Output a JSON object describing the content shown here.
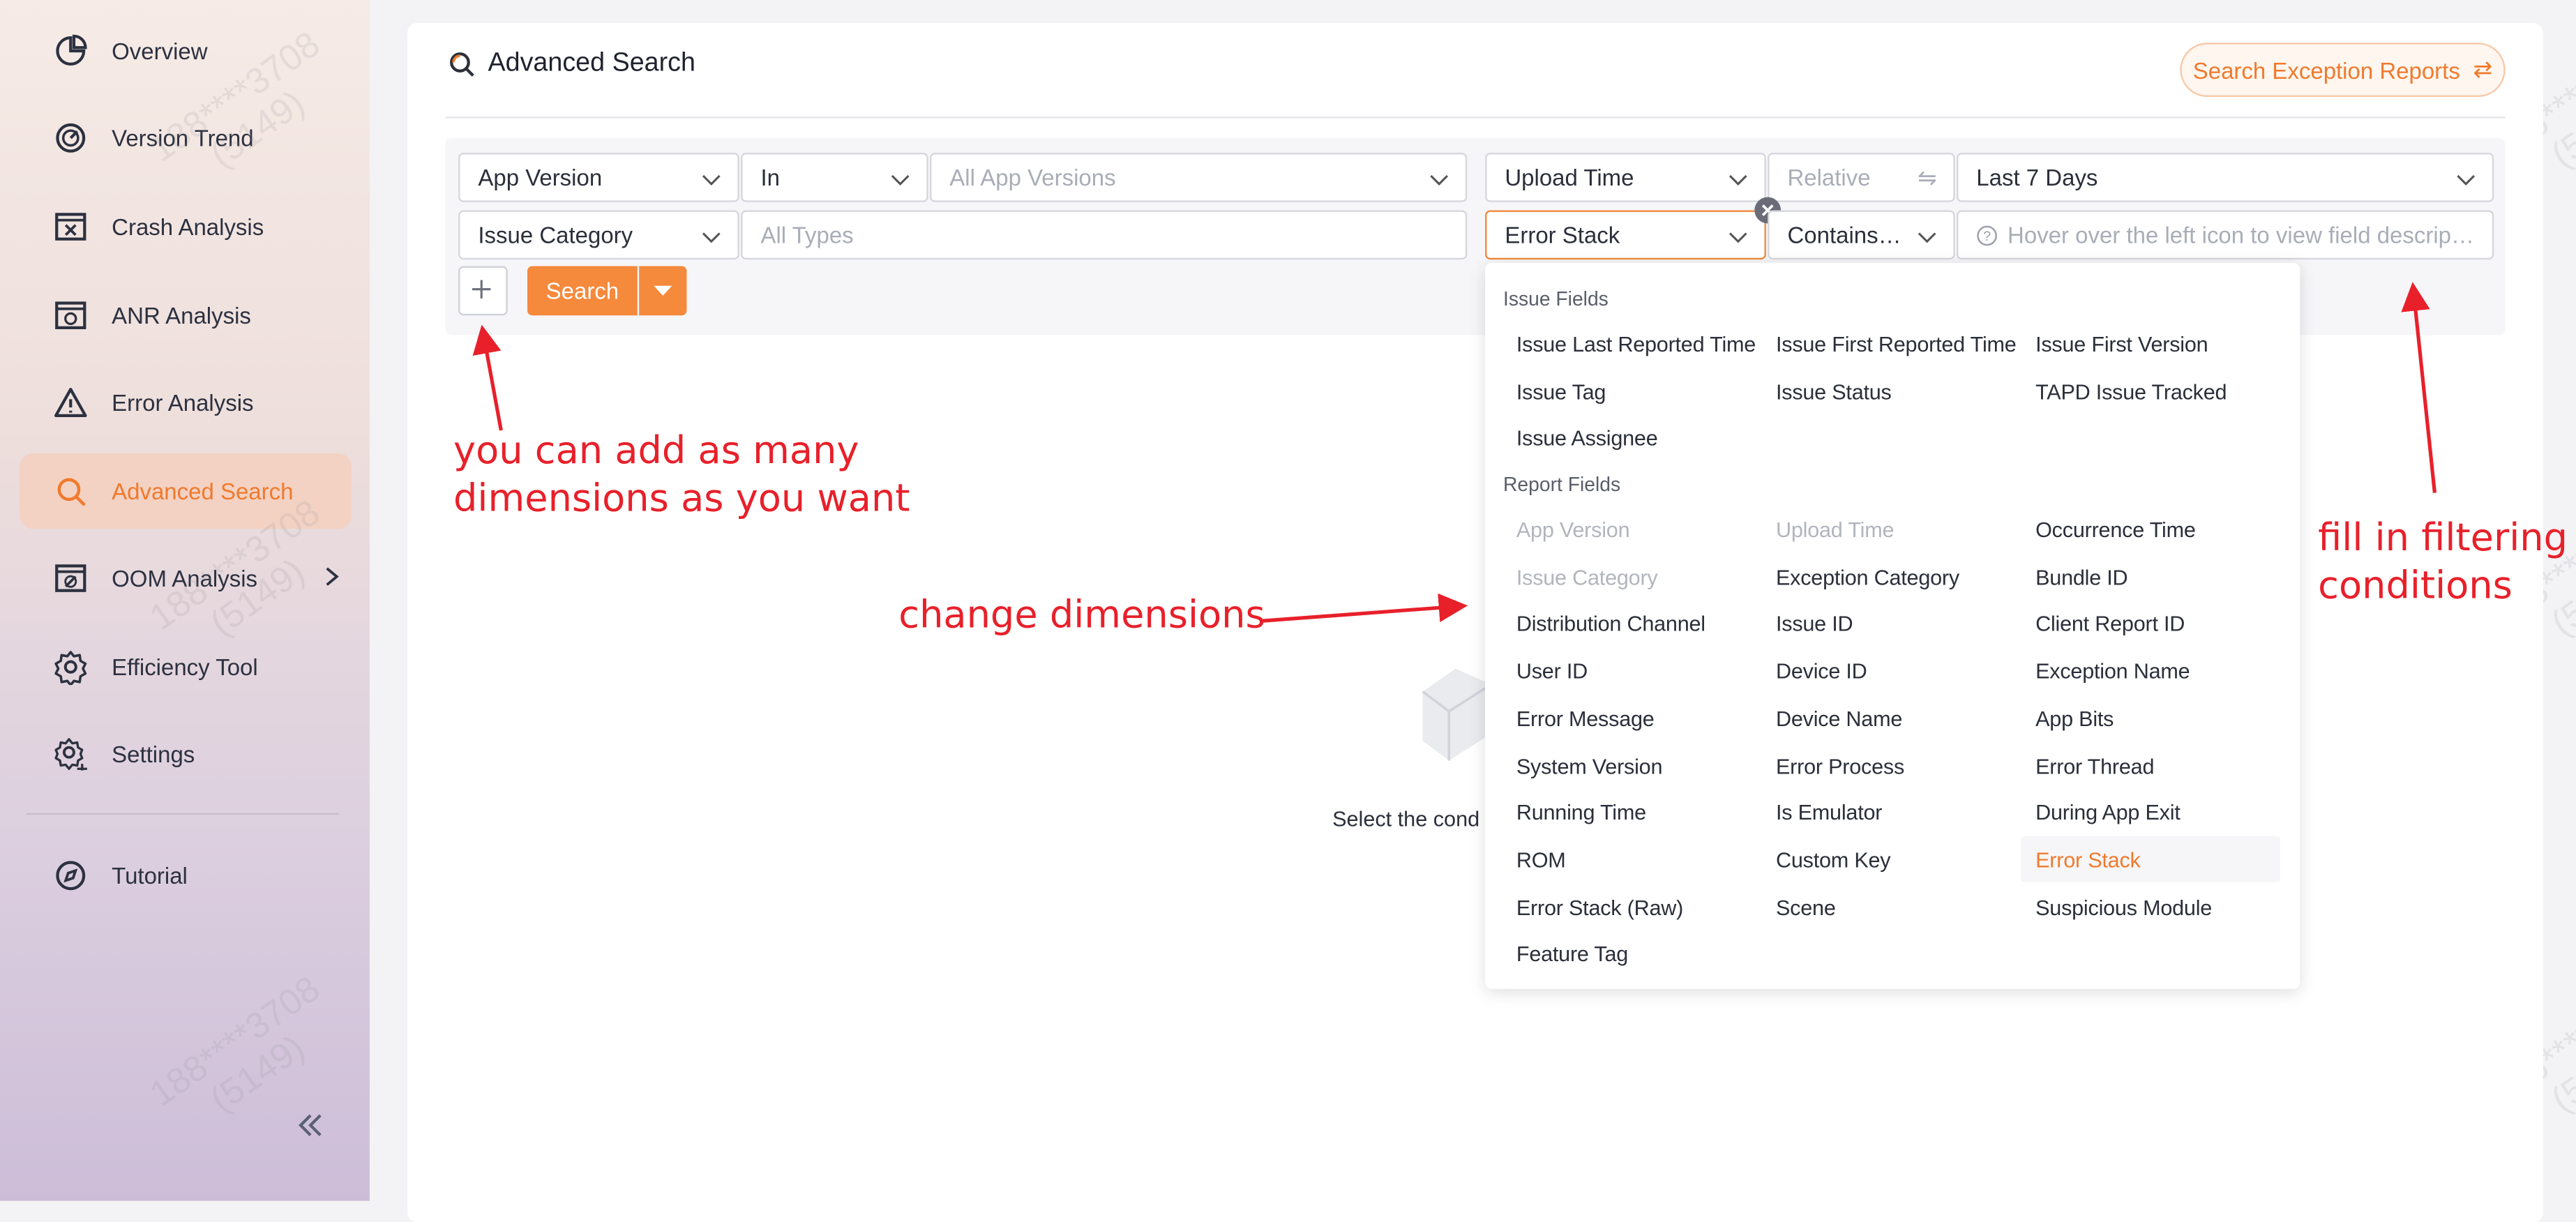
{
  "sidebar": {
    "items": [
      {
        "label": "Overview",
        "icon": "pie-chart-icon"
      },
      {
        "label": "Version Trend",
        "icon": "trend-gauge-icon"
      },
      {
        "label": "Crash Analysis",
        "icon": "crash-window-icon"
      },
      {
        "label": "ANR Analysis",
        "icon": "anr-window-icon"
      },
      {
        "label": "Error Analysis",
        "icon": "warning-triangle-icon"
      },
      {
        "label": "Advanced Search",
        "icon": "advanced-search-icon",
        "active": true
      },
      {
        "label": "OOM Analysis",
        "icon": "oom-window-icon",
        "has_submenu": true
      },
      {
        "label": "Efficiency Tool",
        "icon": "gear-icon"
      },
      {
        "label": "Settings",
        "icon": "settings-gear-icon"
      },
      {
        "label": "Tutorial",
        "icon": "compass-icon"
      }
    ]
  },
  "main": {
    "title": "Advanced Search",
    "exception_reports_button": "Search Exception Reports",
    "row1": {
      "dimension": "App Version",
      "operator": "In",
      "value_placeholder": "All App Versions",
      "time_field": "Upload Time",
      "time_mode": "Relative",
      "time_range": "Last 7 Days"
    },
    "row2": {
      "dimension": "Issue Category",
      "value_placeholder": "All Types",
      "field": "Error Stack",
      "operator": "Contains …",
      "hint_placeholder": "Hover over the left icon to view field descrip…"
    },
    "search_button": "Search",
    "empty_state": "Select the cond"
  },
  "dropdown": {
    "issue_fields_label": "Issue Fields",
    "issue_fields": [
      "Issue Last Reported Time",
      "Issue First Reported Time",
      "Issue First Version",
      "Issue Tag",
      "Issue Status",
      "TAPD Issue Tracked",
      "Issue Assignee"
    ],
    "report_fields_label": "Report Fields",
    "report_fields": [
      "App Version",
      "Upload Time",
      "Occurrence Time",
      "Issue Category",
      "Exception Category",
      "Bundle ID",
      "Distribution Channel",
      "Issue ID",
      "Client Report ID",
      "User ID",
      "Device ID",
      "Exception Name",
      "Error Message",
      "Device Name",
      "App Bits",
      "System Version",
      "Error Process",
      "Error Thread",
      "Running Time",
      "Is Emulator",
      "During App Exit",
      "ROM",
      "Custom Key",
      "Error Stack",
      "Error Stack (Raw)",
      "Scene",
      "Suspicious Module",
      "Feature Tag"
    ],
    "disabled": [
      "App Version",
      "Upload Time",
      "Issue Category"
    ],
    "selected": "Error Stack"
  },
  "annotations": {
    "add_dimensions": "you can add as many\ndimensions as you want",
    "change_dimensions": "change dimensions",
    "fill_conditions": "fill in filtering\nconditions"
  },
  "watermark": "188****3708\n(5149)",
  "colors": {
    "accent": "#f07a2c",
    "annotation": "#e8202a"
  }
}
